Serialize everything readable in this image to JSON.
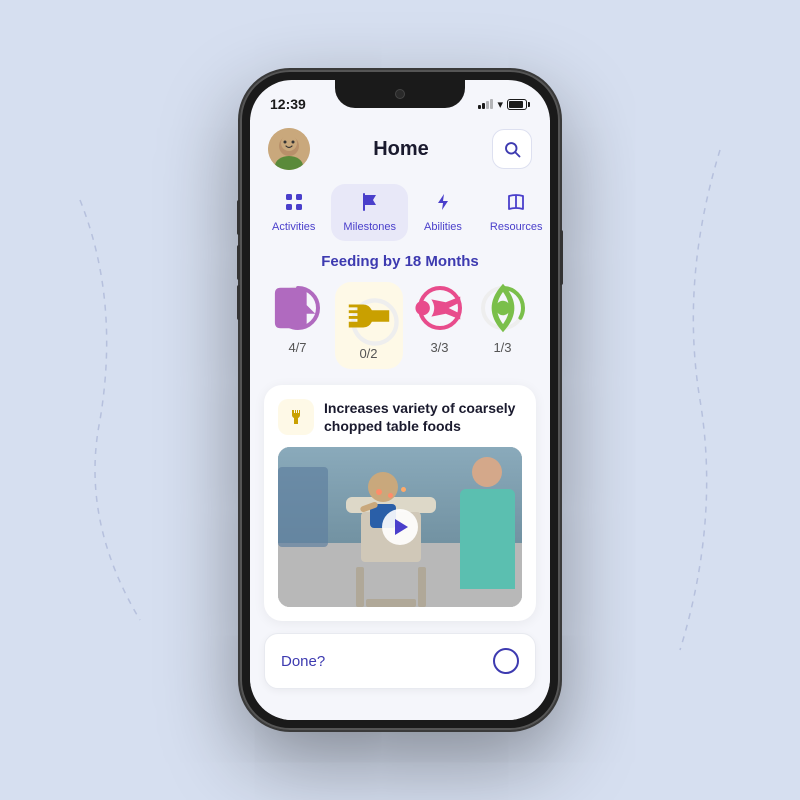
{
  "phone": {
    "status_bar": {
      "time": "12:39"
    }
  },
  "header": {
    "title": "Home"
  },
  "search_button": {
    "label": "Search"
  },
  "nav_tabs": [
    {
      "id": "activities",
      "label": "Activities",
      "icon": "🏠",
      "active": false
    },
    {
      "id": "milestones",
      "label": "Milestones",
      "icon": "🚩",
      "active": true
    },
    {
      "id": "abilities",
      "label": "Abilities",
      "icon": "⚡",
      "active": false
    },
    {
      "id": "resources",
      "label": "Resources",
      "icon": "📖",
      "active": false
    }
  ],
  "section": {
    "title": "Feeding by 18 Months"
  },
  "progress_items": [
    {
      "id": "chat",
      "icon": "💬",
      "value": "4/7",
      "color": "#b06abf",
      "progress": 0.57,
      "highlighted": false
    },
    {
      "id": "food",
      "icon": "🍴",
      "value": "0/2",
      "color": "#c9a000",
      "progress": 0,
      "highlighted": true
    },
    {
      "id": "walk",
      "icon": "🚶",
      "value": "3/3",
      "color": "#e84c8c",
      "progress": 1.0,
      "highlighted": false
    },
    {
      "id": "eye",
      "icon": "👁",
      "value": "1/3",
      "color": "#7abf4a",
      "progress": 0.33,
      "highlighted": false
    }
  ],
  "card": {
    "title": "Increases variety of coarsely chopped table foods",
    "icon": "🍴"
  },
  "done_field": {
    "label": "Done?"
  },
  "decoration": {
    "dashed_paths": true
  }
}
